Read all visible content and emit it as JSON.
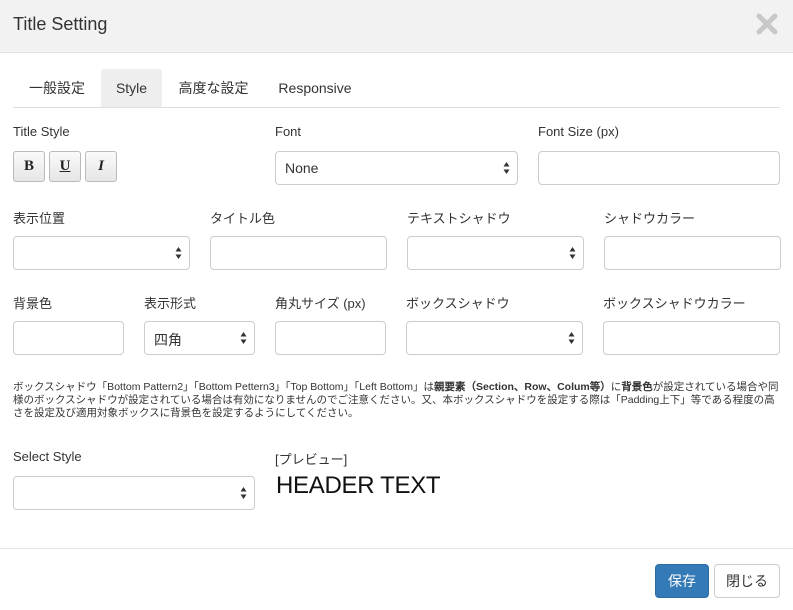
{
  "dialog": {
    "title": "Title Setting"
  },
  "icons": {
    "close": "close-icon",
    "select_arrow": "updown-arrow-icon"
  },
  "tabs": [
    {
      "label": "一般設定"
    },
    {
      "label": "Style",
      "active": true
    },
    {
      "label": "高度な設定"
    },
    {
      "label": "Responsive"
    }
  ],
  "row1": {
    "title_style": {
      "label": "Title Style",
      "bold": "B",
      "underline": "U",
      "italic": "I"
    },
    "font": {
      "label": "Font",
      "value": "None"
    },
    "font_size": {
      "label": "Font Size (px)",
      "value": ""
    }
  },
  "row2": {
    "display_position": {
      "label": "表示位置",
      "value": ""
    },
    "title_color": {
      "label": "タイトル色",
      "value": ""
    },
    "text_shadow": {
      "label": "テキストシャドウ",
      "value": ""
    },
    "shadow_color": {
      "label": "シャドウカラー",
      "value": ""
    }
  },
  "row3": {
    "bg_color": {
      "label": "背景色",
      "value": ""
    },
    "display_format": {
      "label": "表示形式",
      "value": "四角"
    },
    "corner_size": {
      "label": "角丸サイズ (px)",
      "value": ""
    },
    "box_shadow": {
      "label": "ボックスシャドウ",
      "value": ""
    },
    "box_shadow_color": {
      "label": "ボックスシャドウカラー",
      "value": ""
    }
  },
  "note": {
    "p1": "ボックスシャドウ「Bottom Pattern2」「Bottom Pettern3」「Top Bottom」「Left Bottom」は",
    "b1": "親要素（Section、Row、Colum等）",
    "p2": "に",
    "b2": "背景色",
    "p3": "が設定されている場合や同様のボックスシャドウが設定されている場合は有効になりませんのでご注意ください。又、本ボックスシャドウを設定する際は「Padding上下」等である程度の高さを設定及び適用対象ボックスに背景色を設定するようにしてください。"
  },
  "select_style": {
    "label": "Select Style",
    "value": ""
  },
  "preview": {
    "label": "[プレビュー]",
    "text": "HEADER TEXT"
  },
  "footer": {
    "save": "保存",
    "close": "閉じる"
  },
  "colors": {
    "primary": "#337ab7",
    "header_bg": "#f2f2f2",
    "close_icon": "#c8c8c8"
  }
}
